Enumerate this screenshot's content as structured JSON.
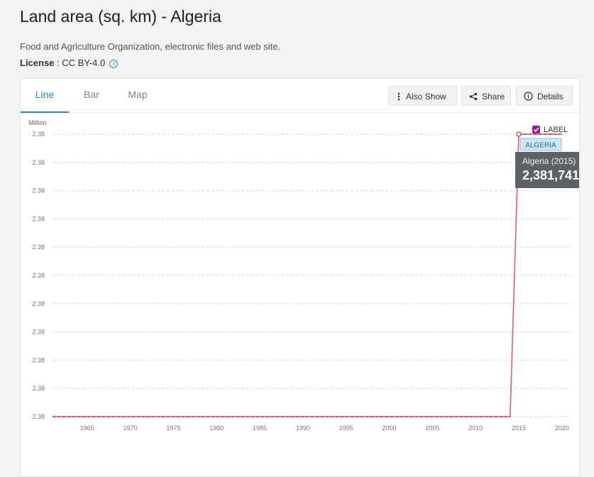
{
  "header": {
    "title": "Land area (sq. km) - Algeria",
    "source": "Food and Agriculture Organization, electronic files and web site.",
    "license_label": "License",
    "license_value": " : CC BY-4.0"
  },
  "tabs": [
    "Line",
    "Bar",
    "Map"
  ],
  "active_tab": "Line",
  "toolbar": {
    "also_show": "Also Show",
    "share": "Share",
    "details": "Details"
  },
  "legend": {
    "label_toggle": "LABEL",
    "label_checked": true,
    "series_badge": "ALGERIA"
  },
  "tooltip": {
    "title": "Algeria (2015)",
    "value": "2,381,741"
  },
  "colors": {
    "accent": "#1a8fd6",
    "series": "#e8525f",
    "checkbox": "#9b1e9b",
    "tooltip_bg": "#5d6166"
  },
  "chart_data": {
    "type": "line",
    "ylabel": "Million",
    "y_tick_labels": [
      "2.38",
      "2.38",
      "2.38",
      "2.38",
      "2.38",
      "2.38",
      "2.38",
      "2.38",
      "2.38",
      "2.38",
      "2.38"
    ],
    "x_ticks": [
      1965,
      1970,
      1975,
      1980,
      1985,
      1990,
      1995,
      2000,
      2005,
      2010,
      2015,
      2020
    ],
    "x_range": [
      1961,
      2021
    ],
    "y_range": [
      2381740,
      2381741
    ],
    "grid": true,
    "series": [
      {
        "name": "ALGERIA",
        "x": [
          1961,
          2014,
          2015,
          2020
        ],
        "y": [
          2381740,
          2381740,
          2381741,
          2381741
        ],
        "dashed_segments": [
          [
            1961,
            2014
          ],
          [
            2015,
            2020
          ]
        ],
        "highlight_point": [
          2015,
          2381741
        ]
      }
    ]
  }
}
